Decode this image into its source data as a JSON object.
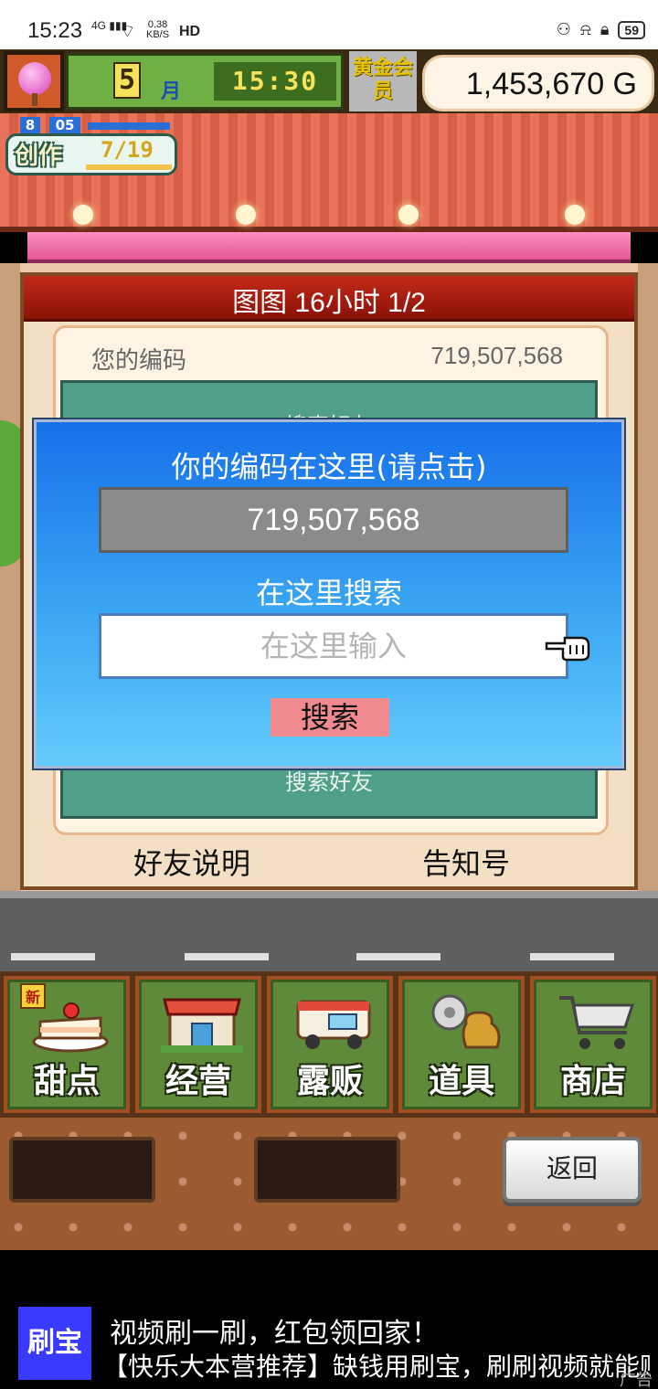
{
  "status_bar": {
    "time": "15:23",
    "network": "4G",
    "speed": "0.38",
    "speed_unit": "KB/S",
    "hd": "HD",
    "battery": "59"
  },
  "header": {
    "month": "5",
    "month_label": "月",
    "clock": "15:30",
    "gold_member": "黄金会员",
    "money": "1,453,670 G"
  },
  "creation": {
    "level_a": "8",
    "level_b": "05",
    "label": "创作",
    "progress": "7/19"
  },
  "panel": {
    "title": "图图  16小时 1/2",
    "code_label": "您的编码",
    "code_value": "719,507,568",
    "teal_top_text": "搜索好友",
    "teal_bottom_text": "搜索好友",
    "tab_friends": "好友说明",
    "tab_notice": "告知号"
  },
  "dialog": {
    "title": "你的编码在这里(请点击)",
    "code": "719,507,568",
    "search_label": "在这里搜索",
    "search_placeholder": "在这里输入",
    "search_button": "搜索"
  },
  "menu": {
    "new_badge": "新",
    "items": [
      {
        "label": "甜点",
        "icon": "cake-icon"
      },
      {
        "label": "经营",
        "icon": "shop-icon"
      },
      {
        "label": "露贩",
        "icon": "food-truck-icon"
      },
      {
        "label": "道具",
        "icon": "items-icon"
      },
      {
        "label": "商店",
        "icon": "cart-icon"
      }
    ]
  },
  "footer": {
    "back_button": "返回"
  },
  "ad": {
    "logo": "刷宝",
    "title": "视频刷一刷，红包领回家！",
    "body": "【快乐大本营推荐】缺钱用刷宝，刷刷视频就能赚",
    "tag": "广告"
  }
}
